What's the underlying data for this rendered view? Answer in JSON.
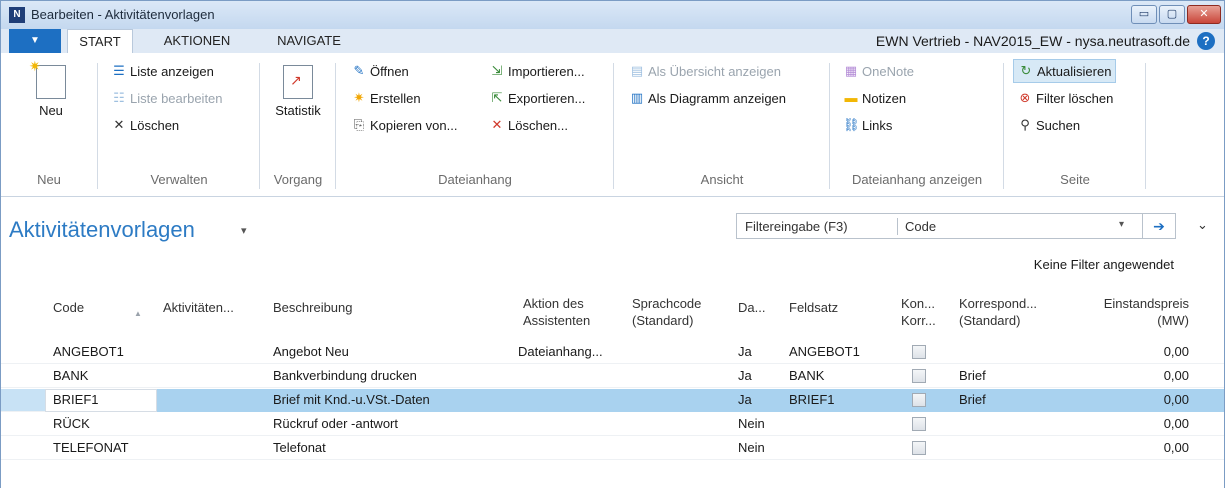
{
  "window": {
    "title": "Bearbeiten - Aktivitätenvorlagen",
    "app_icon": "nav-logo-icon",
    "btn_min": "▭",
    "btn_max": "▢",
    "btn_close": "✕"
  },
  "tabs": {
    "file": "▼",
    "start": "START",
    "aktionen": "AKTIONEN",
    "navigate": "NAVIGATE",
    "company": "EWN Vertrieb - NAV2015_EW - nysa.neutrasoft.de",
    "help": "?"
  },
  "ribbon": {
    "neu": {
      "label": "Neu",
      "group": "Neu"
    },
    "verwalten": {
      "group": "Verwalten",
      "liste_anzeigen": "Liste anzeigen",
      "liste_bearbeiten": "Liste bearbeiten",
      "loeschen": "Löschen"
    },
    "vorgang": {
      "group": "Vorgang",
      "statistik": "Statistik"
    },
    "dateianhang": {
      "group": "Dateianhang",
      "oeffnen": "Öffnen",
      "erstellen": "Erstellen",
      "kopieren": "Kopieren von...",
      "importieren": "Importieren...",
      "exportieren": "Exportieren...",
      "loeschen": "Löschen..."
    },
    "ansicht": {
      "group": "Ansicht",
      "uebersicht": "Als Übersicht anzeigen",
      "diagramm": "Als Diagramm anzeigen"
    },
    "dateianhang_anzeigen": {
      "group": "Dateianhang anzeigen",
      "onenote": "OneNote",
      "notizen": "Notizen",
      "links": "Links"
    },
    "seite": {
      "group": "Seite",
      "aktualisieren": "Aktualisieren",
      "filter_loeschen": "Filter löschen",
      "suchen": "Suchen"
    }
  },
  "page": {
    "title": "Aktivitätenvorlagen",
    "title_caret": "▾",
    "filter_label": "Filtereingabe (F3)",
    "filter_field": "Code",
    "filter_dropdown": "▾",
    "filter_go": "➔",
    "collapse": "⌄",
    "no_filter": "Keine Filter angewendet"
  },
  "table": {
    "headers": {
      "code": "Code",
      "aktivitaeten": "Aktivitäten...",
      "beschreibung": "Beschreibung",
      "aktion_1": "Aktion des",
      "aktion_2": "Assistenten",
      "sprach_1": "Sprachcode",
      "sprach_2": "(Standard)",
      "da": "Da...",
      "feldsatz": "Feldsatz",
      "kon_1": "Kon...",
      "kon_2": "Korr...",
      "korr_1": "Korrespond...",
      "korr_2": "(Standard)",
      "einst_1": "Einstandspreis",
      "einst_2": "(MW)",
      "sort_arrow": "▲"
    },
    "rows": [
      {
        "code": "ANGEBOT1",
        "aktivitaeten": "",
        "beschreibung": "Angebot Neu",
        "aktion": "Dateianhang...",
        "sprachcode": "",
        "da": "Ja",
        "feldsatz": "ANGEBOT1",
        "kon_korr": false,
        "korrespondenz": "",
        "einstandspreis": "0,00"
      },
      {
        "code": "BANK",
        "aktivitaeten": "",
        "beschreibung": "Bankverbindung drucken",
        "aktion": "",
        "sprachcode": "",
        "da": "Ja",
        "feldsatz": "BANK",
        "kon_korr": false,
        "korrespondenz": "Brief",
        "einstandspreis": "0,00"
      },
      {
        "code": "BRIEF1",
        "aktivitaeten": "",
        "beschreibung": "Brief mit Knd.-u.VSt.-Daten",
        "aktion": "",
        "sprachcode": "",
        "da": "Ja",
        "feldsatz": "BRIEF1",
        "kon_korr": false,
        "korrespondenz": "Brief",
        "einstandspreis": "0,00",
        "selected": true
      },
      {
        "code": "RÜCK",
        "aktivitaeten": "",
        "beschreibung": "Rückruf oder -antwort",
        "aktion": "",
        "sprachcode": "",
        "da": "Nein",
        "feldsatz": "",
        "kon_korr": false,
        "korrespondenz": "",
        "einstandspreis": "0,00"
      },
      {
        "code": "TELEFONAT",
        "aktivitaeten": "",
        "beschreibung": "Telefonat",
        "aktion": "",
        "sprachcode": "",
        "da": "Nein",
        "feldsatz": "",
        "kon_korr": false,
        "korrespondenz": "",
        "einstandspreis": "0,00"
      }
    ]
  }
}
